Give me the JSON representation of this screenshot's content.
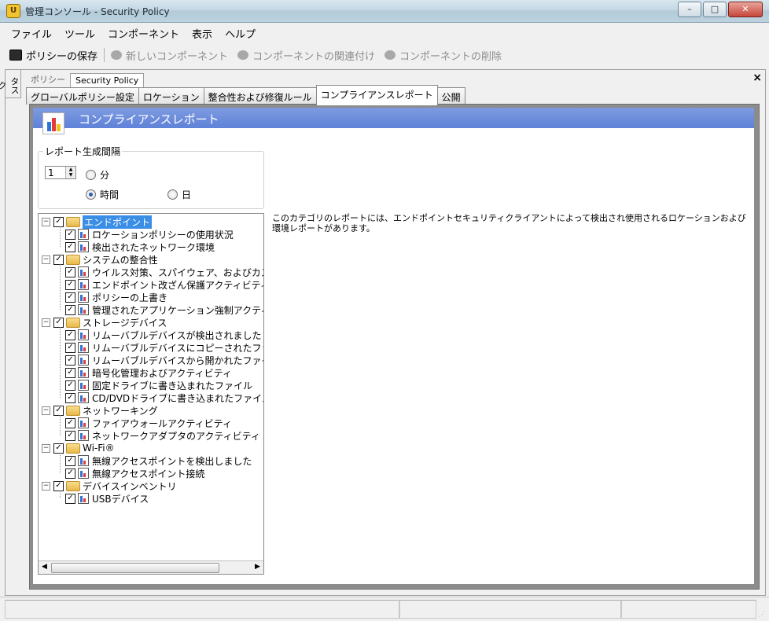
{
  "window": {
    "title": "管理コンソール - Security Policy",
    "controls": [
      "–",
      "□",
      "✕"
    ]
  },
  "menu": [
    "ファイル",
    "ツール",
    "コンポーネント",
    "表示",
    "ヘルプ"
  ],
  "toolbar": {
    "save": "ポリシーの保存",
    "new_component": "新しいコンポーネント",
    "associate": "コンポーネントの関連付け",
    "delete": "コンポーネントの削除"
  },
  "side_tab": "タスク",
  "doc_tabs": [
    "ポリシー",
    "Security Policy"
  ],
  "doc_close": "×",
  "tabs": [
    "グローバルポリシー設定",
    "ロケーション",
    "整合性および修復ルール",
    "コンプライアンスレポート",
    "公開"
  ],
  "header_title": "コンプライアンスレポート",
  "interval": {
    "label": "レポート生成間隔",
    "value": "1",
    "options": [
      "分",
      "時間",
      "日"
    ],
    "selected": "時間"
  },
  "tree": [
    {
      "label": "エンドポイント",
      "children": [
        "ロケーションポリシーの使用状況",
        "検出されたネットワーク環境"
      ]
    },
    {
      "label": "システムの整合性",
      "children": [
        "ウイルス対策、スパイウェア、およびカスタムル",
        "エンドポイント改ざん保護アクティビティ",
        "ポリシーの上書き",
        "管理されたアプリケーション強制アクティビティ"
      ]
    },
    {
      "label": "ストレージデバイス",
      "children": [
        "リムーバブルデバイスが検出されました",
        "リムーバブルデバイスにコピーされたファイル",
        "リムーバブルデバイスから開かれたファイル",
        "暗号化管理およびアクティビティ",
        "固定ドライブに書き込まれたファイル",
        "CD/DVDドライブに書き込まれたファイル"
      ]
    },
    {
      "label": "ネットワーキング",
      "children": [
        "ファイアウォールアクティビティ",
        "ネットワークアダプタのアクティビティ"
      ]
    },
    {
      "label": "Wi-Fi®",
      "children": [
        "無線アクセスポイントを検出しました",
        "無線アクセスポイント接続"
      ]
    },
    {
      "label": "デバイスインベントリ",
      "children": [
        "USBデバイス"
      ]
    }
  ],
  "description": "このカテゴリのレポートには、エンドポイントセキュリティクライアントによって検出され使用されるロケーションおよび環境レポートがあります。",
  "colors": {
    "header": "#6585d9",
    "selection": "#3a8ee6"
  }
}
